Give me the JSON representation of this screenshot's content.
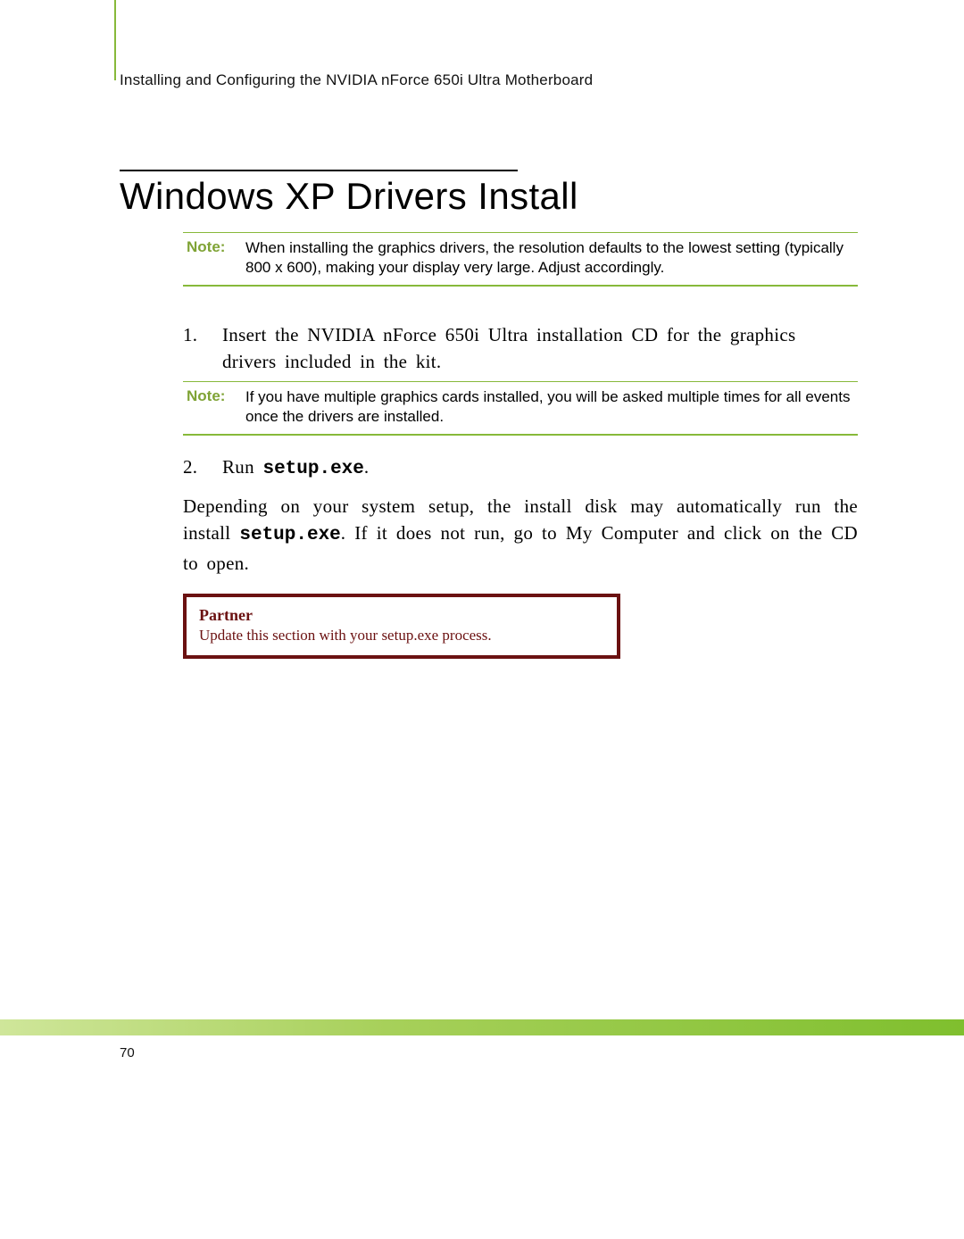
{
  "header": "Installing and Configuring the NVIDIA nForce 650i Ultra Motherboard",
  "title": "Windows XP Drivers Install",
  "note1": {
    "label": "Note:",
    "text": "When installing the graphics drivers, the resolution defaults to the lowest setting (typically 800 x 600), making your display very large. Adjust accordingly."
  },
  "step1": {
    "num": "1.",
    "text": "Insert the NVIDIA nForce 650i Ultra installation CD for the graphics drivers included in the kit."
  },
  "note2": {
    "label": "Note:",
    "text": "If you have multiple graphics cards installed, you will be asked multiple times for all events once the drivers are installed."
  },
  "step2": {
    "num": "2.",
    "pre": "Run ",
    "code": "setup.exe",
    "post": "."
  },
  "para": {
    "pre": "Depending on your system setup, the install disk may automatically run the install ",
    "code": "setup.exe",
    "post": ". If it does not run, go to My Computer and click on the CD to open."
  },
  "partner": {
    "title": "Partner",
    "body": "Update this section with your setup.exe process."
  },
  "page_number": "70"
}
